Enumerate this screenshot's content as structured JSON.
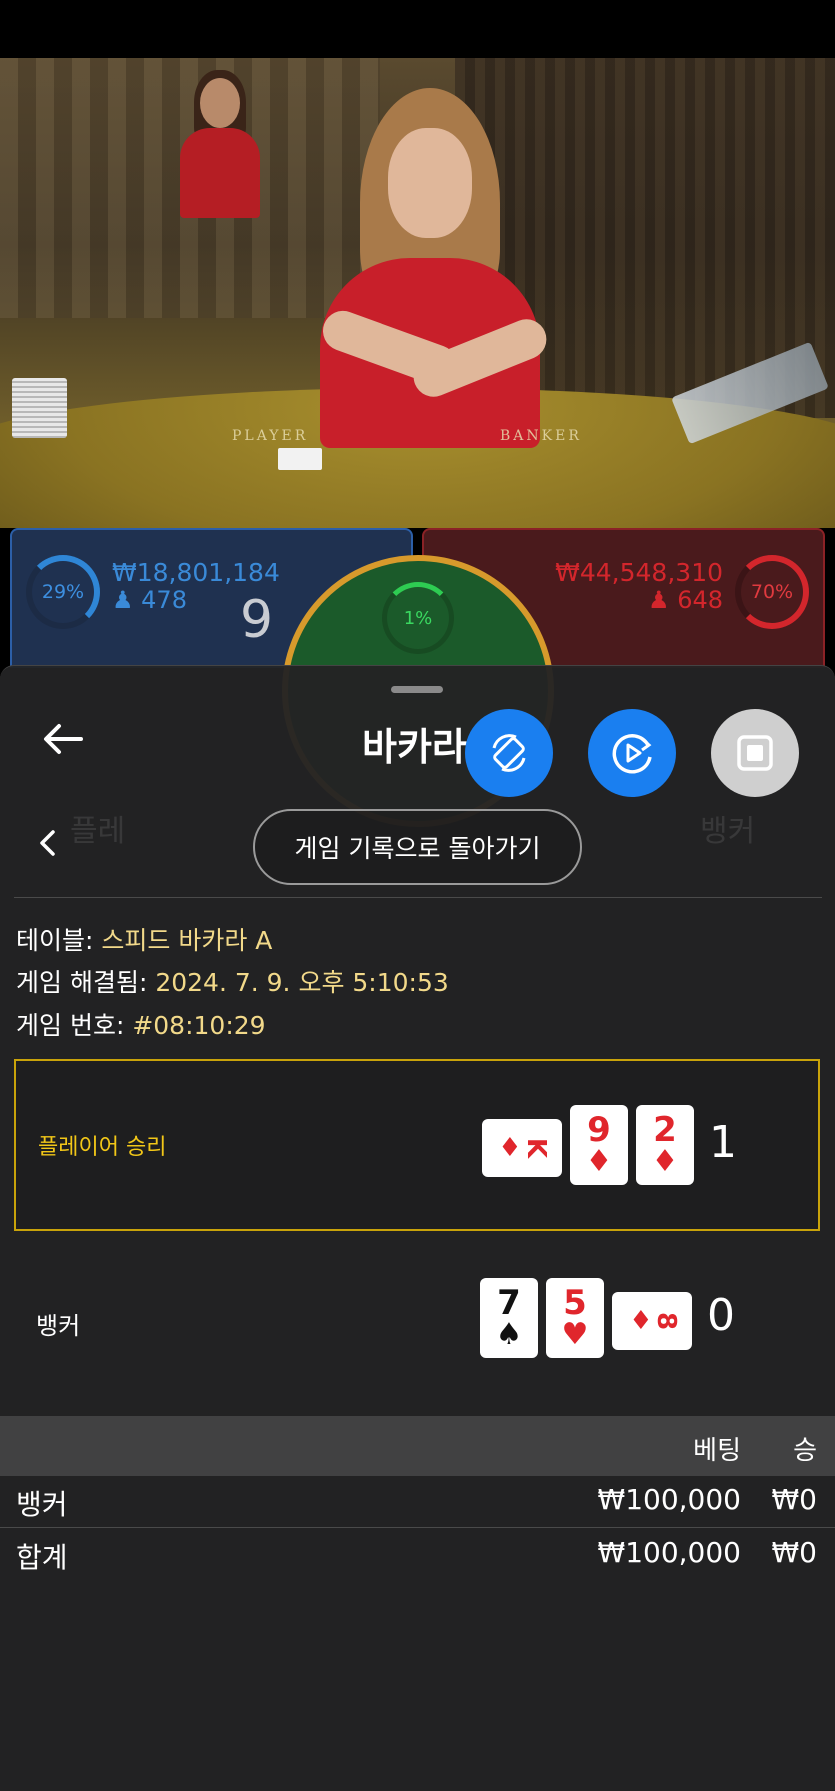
{
  "bet_bar": {
    "player_percent": "29%",
    "player_amount": "₩18,801,184",
    "player_count": "478",
    "player_score": "9",
    "banker_percent": "70%",
    "banker_amount": "₩44,548,310",
    "banker_count": "648",
    "tie_percent": "1%"
  },
  "video": {
    "table_label_player": "PLAYER",
    "table_label_banker": "BANKER"
  },
  "panel": {
    "title": "바카라",
    "history_button": "게임 기록으로 돌아가기",
    "info": {
      "table_label": "테이블: ",
      "table_value": "스피드 바카라 A",
      "resolved_label": "게임 해결됨: ",
      "resolved_value": "2024. 7. 9. 오후 5:10:53",
      "game_no_label": "게임 번호: ",
      "game_no_value": "#08:10:29"
    },
    "result": {
      "player_label": "플레이어 승리",
      "player_total": "1",
      "player_cards": [
        {
          "rank": "K",
          "suit": "♦",
          "color": "red",
          "sideways": true
        },
        {
          "rank": "9",
          "suit": "♦",
          "color": "red",
          "sideways": false
        },
        {
          "rank": "2",
          "suit": "♦",
          "color": "red",
          "sideways": false
        }
      ],
      "banker_label": "뱅커",
      "banker_total": "0",
      "banker_cards": [
        {
          "rank": "7",
          "suit": "♠",
          "color": "black",
          "sideways": false
        },
        {
          "rank": "5",
          "suit": "♥",
          "color": "red",
          "sideways": false
        },
        {
          "rank": "8",
          "suit": "♦",
          "color": "red",
          "sideways": true
        }
      ]
    },
    "bets": {
      "col_bet": "베팅",
      "col_win": "승",
      "rows": [
        {
          "name": "뱅커",
          "bet": "₩100,000",
          "win": "₩0"
        },
        {
          "name": "합계",
          "bet": "₩100,000",
          "win": "₩0"
        }
      ]
    }
  },
  "colors": {
    "accent_blue": "#1a7ff0",
    "player_blue": "#2f86d6",
    "banker_red": "#d3262c",
    "tie_green": "#2ecc52",
    "highlight_yellow": "#c9a30a"
  },
  "icons": [
    "back-arrow-icon",
    "rotate-icon",
    "video-replay-icon",
    "stop-icon",
    "chevron-left-icon",
    "person-icon"
  ]
}
